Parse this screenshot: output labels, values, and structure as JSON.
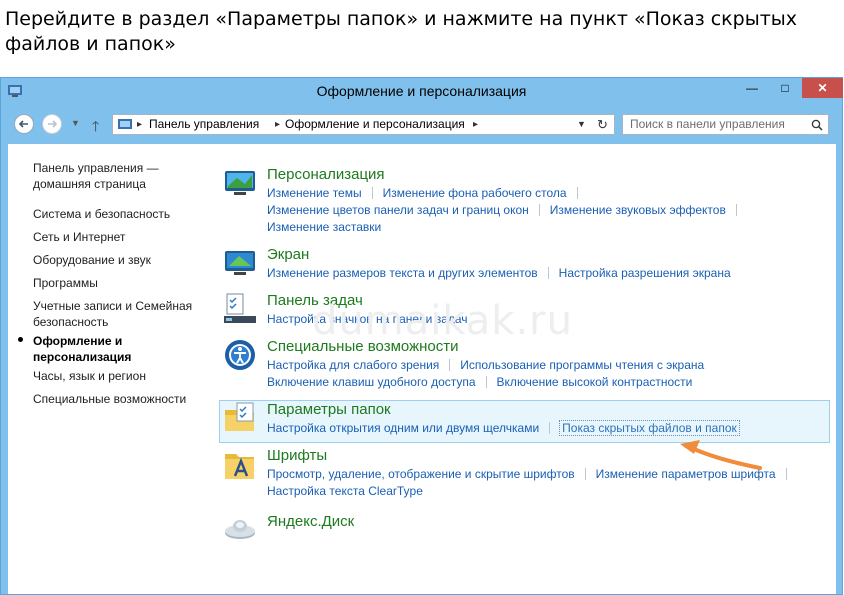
{
  "instruction": "Перейдите в раздел «Параметры папок» и нажмите на пункт «Показ скрытых файлов и папок»",
  "window": {
    "title": "Оформление и персонализация",
    "buttons": {
      "minimize": "—",
      "maximize": "□",
      "close": "✕"
    }
  },
  "address": {
    "crumbs": [
      "Панель управления",
      "Оформление и персонализация"
    ],
    "separator": "▸"
  },
  "search": {
    "placeholder": "Поиск в панели управления"
  },
  "sidebar": {
    "items": [
      {
        "label": "Панель управления — домашняя страница"
      },
      {
        "label": "Система и безопасность"
      },
      {
        "label": "Сеть и Интернет"
      },
      {
        "label": "Оборудование и звук"
      },
      {
        "label": "Программы"
      },
      {
        "label": "Учетные записи и Семейная безопасность"
      },
      {
        "label": "Оформление и персонализация",
        "active": true
      },
      {
        "label": "Часы, язык и регион"
      },
      {
        "label": "Специальные возможности"
      }
    ]
  },
  "categories": [
    {
      "title": "Персонализация",
      "icon": "personalization-icon",
      "rows": [
        [
          "Изменение темы",
          "Изменение фона рабочего стола"
        ],
        [
          "Изменение цветов панели задач и границ окон",
          "Изменение звуковых эффектов"
        ],
        [
          "Изменение заставки"
        ]
      ]
    },
    {
      "title": "Экран",
      "icon": "display-icon",
      "rows": [
        [
          "Изменение размеров текста и других элементов",
          "Настройка разрешения экрана"
        ]
      ]
    },
    {
      "title": "Панель задач",
      "icon": "taskbar-icon",
      "rows": [
        [
          "Настройка значков на панели задач"
        ]
      ]
    },
    {
      "title": "Специальные возможности",
      "icon": "accessibility-icon",
      "rows": [
        [
          "Настройка для слабого зрения",
          "Использование программы чтения с экрана"
        ],
        [
          "Включение клавиш удобного доступа",
          "Включение высокой контрастности"
        ]
      ]
    },
    {
      "title": "Параметры папок",
      "icon": "folder-options-icon",
      "highlighted": true,
      "rows": [
        [
          "Настройка открытия одним или двумя щелчками",
          "Показ скрытых файлов и папок"
        ]
      ]
    },
    {
      "title": "Шрифты",
      "icon": "fonts-icon",
      "rows": [
        [
          "Просмотр, удаление, отображение и скрытие шрифтов",
          "Изменение параметров шрифта"
        ],
        [
          "Настройка текста ClearType"
        ]
      ]
    },
    {
      "title": "Яндекс.Диск",
      "icon": "yandex-disk-icon",
      "rows": []
    }
  ],
  "watermark": "dumaikak.ru",
  "colors": {
    "titlebar": "#7fc0ed",
    "link": "#1a5fb4",
    "category": "#1e7a1e",
    "highlight": "#e7f5fd",
    "arrow": "#f08c3a"
  }
}
